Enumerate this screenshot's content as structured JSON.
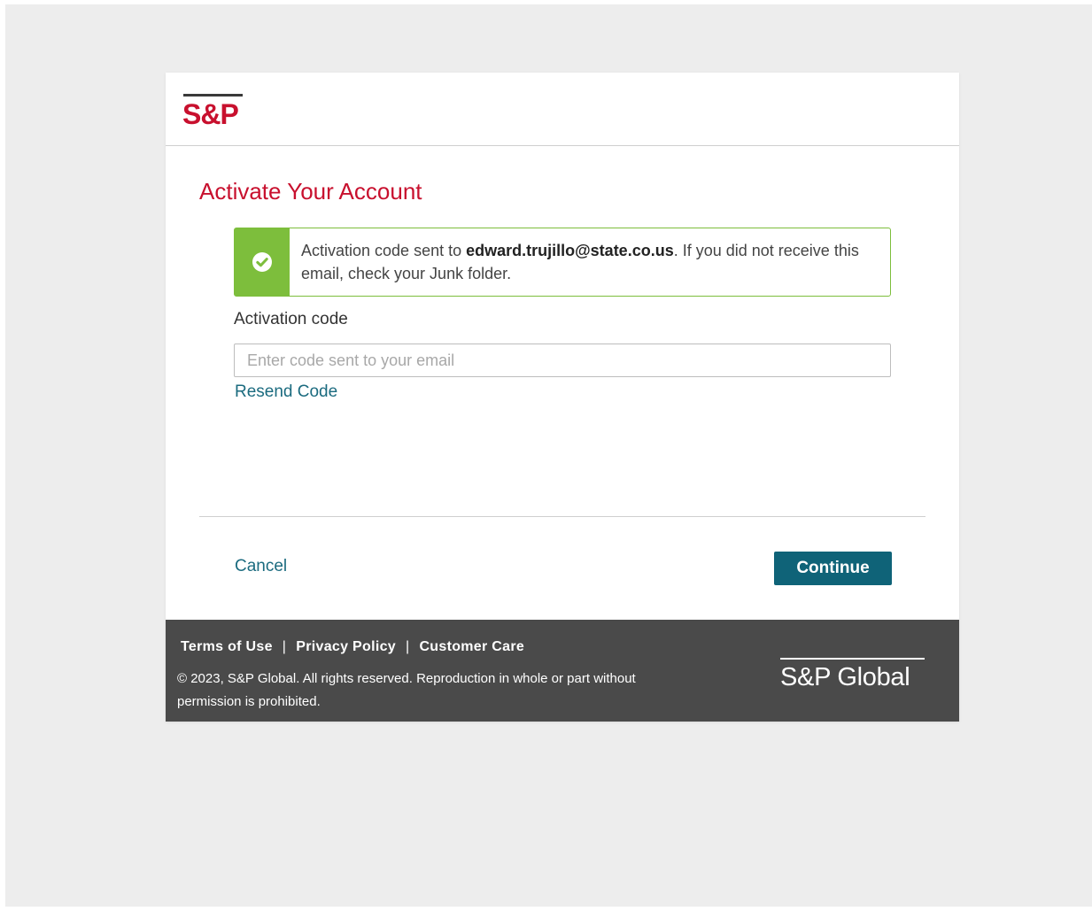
{
  "header": {
    "logo_text": "S&P"
  },
  "main": {
    "title": "Activate Your Account",
    "alert": {
      "icon": "check-circle-icon",
      "text_before": "Activation code sent to ",
      "email": "edward.trujillo@state.co.us",
      "text_after": ". If you did not receive this email, check your Junk folder."
    },
    "activation_field": {
      "label": "Activation code",
      "value": "",
      "placeholder": "Enter code sent to your email"
    },
    "resend_label": "Resend Code"
  },
  "actions": {
    "cancel_label": "Cancel",
    "continue_label": "Continue"
  },
  "footer": {
    "links": [
      "Terms of Use",
      "Privacy Policy",
      "Customer Care"
    ],
    "separator": "|",
    "copyright": "© 2023, S&P Global. All rights reserved. Reproduction in whole or part without permission is prohibited.",
    "logo_text": "S&P Global"
  },
  "colors": {
    "brand_red": "#c8102e",
    "success_green": "#7dbe3c",
    "link_teal": "#1b6b7f",
    "button_teal": "#0f6378",
    "footer_gray": "#4a4a4a",
    "page_bg": "#ededed"
  }
}
